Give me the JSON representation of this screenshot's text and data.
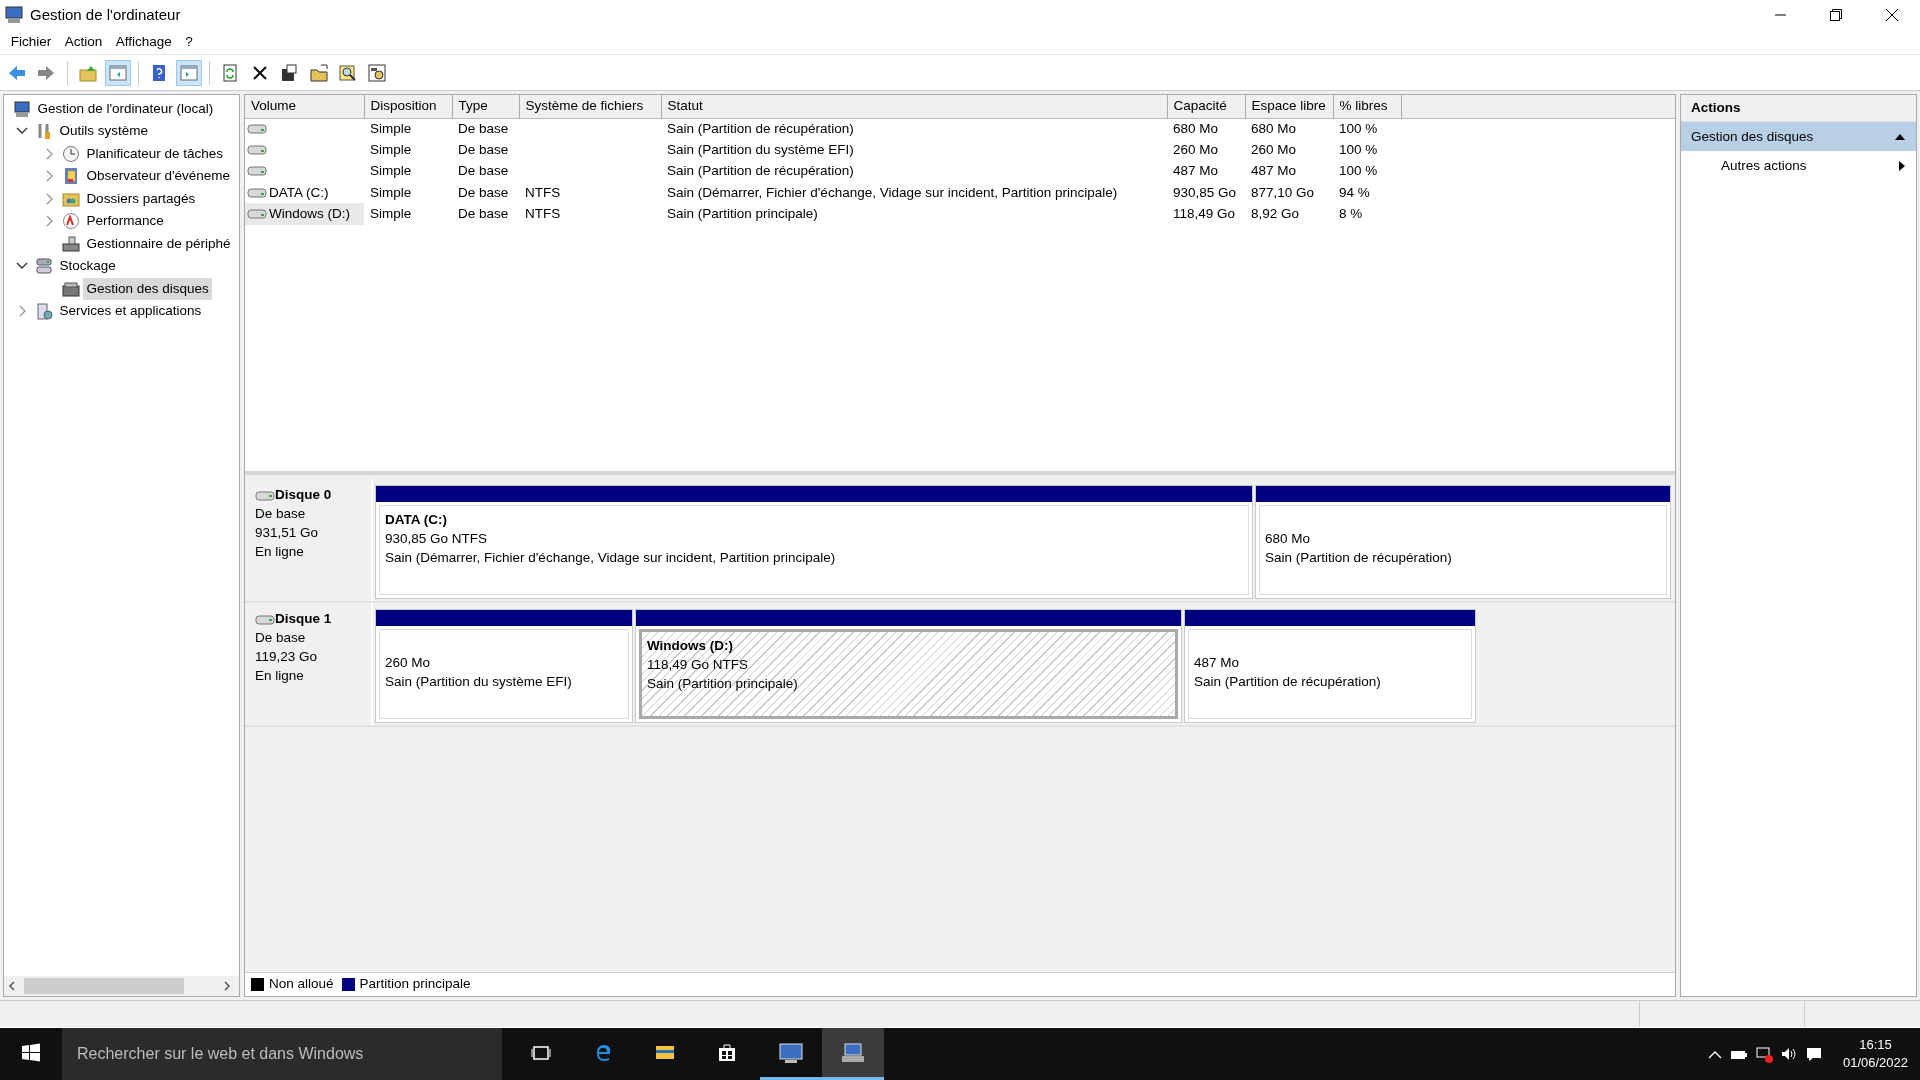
{
  "window": {
    "title": "Gestion de l'ordinateur"
  },
  "menu": [
    "Fichier",
    "Action",
    "Affichage",
    "?"
  ],
  "toolbar": [
    {
      "kind": "back",
      "pressed": false
    },
    {
      "kind": "forward",
      "pressed": false
    },
    {
      "kind": "sep"
    },
    {
      "kind": "up",
      "pressed": false
    },
    {
      "kind": "tree",
      "pressed": true
    },
    {
      "kind": "sep"
    },
    {
      "kind": "help",
      "pressed": false
    },
    {
      "kind": "pane",
      "pressed": true
    },
    {
      "kind": "sep"
    },
    {
      "kind": "refresh",
      "pressed": false
    },
    {
      "kind": "delete",
      "pressed": false
    },
    {
      "kind": "properties",
      "pressed": false
    },
    {
      "kind": "open",
      "pressed": false
    },
    {
      "kind": "find",
      "pressed": false
    },
    {
      "kind": "settings",
      "pressed": false
    }
  ],
  "tree": [
    {
      "label": "Gestion de l'ordinateur (local)",
      "kind": "computer",
      "selected": false,
      "children": [
        {
          "label": "Outils système",
          "kind": "tools",
          "expanded": true,
          "selected": false,
          "children": [
            {
              "label": "Planificateur de tâches",
              "kind": "clock",
              "expanded": false,
              "selected": false
            },
            {
              "label": "Observateur d'événeme",
              "kind": "log",
              "expanded": false,
              "selected": false
            },
            {
              "label": "Dossiers partagés",
              "kind": "folder",
              "expanded": false,
              "selected": false
            },
            {
              "label": "Performance",
              "kind": "perf",
              "expanded": false,
              "selected": false
            },
            {
              "label": "Gestionnaire de périphé",
              "kind": "devices",
              "selected": false
            }
          ]
        },
        {
          "label": "Stockage",
          "kind": "storage",
          "expanded": true,
          "selected": false,
          "children": [
            {
              "label": "Gestion des disques",
              "kind": "disk",
              "selected": true
            }
          ]
        },
        {
          "label": "Services et applications",
          "kind": "services",
          "expanded": false,
          "selected": false
        }
      ]
    }
  ],
  "table": {
    "columns": [
      "Volume",
      "Disposition",
      "Type",
      "Système de fichiers",
      "Statut",
      "Capacité",
      "Espace libre",
      "% libres"
    ],
    "rows": [
      {
        "selected": false,
        "cells": [
          "",
          "Simple",
          "De base",
          "",
          "Sain (Partition de récupération)",
          "680 Mo",
          "680 Mo",
          "100 %"
        ]
      },
      {
        "selected": false,
        "cells": [
          "",
          "Simple",
          "De base",
          "",
          "Sain (Partition du système EFI)",
          "260 Mo",
          "260 Mo",
          "100 %"
        ]
      },
      {
        "selected": false,
        "cells": [
          "",
          "Simple",
          "De base",
          "",
          "Sain (Partition de récupération)",
          "487 Mo",
          "487 Mo",
          "100 %"
        ]
      },
      {
        "selected": false,
        "cells": [
          "DATA (C:)",
          "Simple",
          "De base",
          "NTFS",
          "Sain (Démarrer, Fichier d'échange, Vidage sur incident, Partition principale)",
          "930,85 Go",
          "877,10 Go",
          "94 %"
        ]
      },
      {
        "selected": true,
        "cells": [
          "Windows (D:)",
          "Simple",
          "De base",
          "NTFS",
          "Sain (Partition principale)",
          "118,49 Go",
          "8,92 Go",
          "8 %"
        ]
      }
    ]
  },
  "disks": [
    {
      "name": "Disque 0",
      "type": "De base",
      "size": "931,51 Go",
      "status": "En ligne",
      "partitions": [
        {
          "label": "DATA  (C:)",
          "size": "930,85 Go NTFS",
          "status": "Sain (Démarrer, Fichier d'échange, Vidage sur incident, Partition principale)",
          "selected": false
        },
        {
          "size": "680 Mo",
          "status": "Sain (Partition de récupération)",
          "selected": false
        }
      ]
    },
    {
      "name": "Disque 1",
      "type": "De base",
      "size": "119,23 Go",
      "status": "En ligne",
      "partitions": [
        {
          "size": "260 Mo",
          "status": "Sain (Partition du système EFI)",
          "selected": false
        },
        {
          "label": "Windows  (D:)",
          "size": "118,49 Go NTFS",
          "status": "Sain (Partition principale)",
          "selected": true
        },
        {
          "size": "487 Mo",
          "status": "Sain (Partition de récupération)",
          "selected": false
        }
      ]
    }
  ],
  "legend": [
    {
      "label": "Non alloué",
      "color": "#000000"
    },
    {
      "label": "Partition principale",
      "color": "#000080"
    }
  ],
  "actions": {
    "title": "Actions",
    "sections": [
      {
        "label": "Gestion des disques",
        "expanded": true,
        "items": [
          "Autres actions"
        ]
      }
    ]
  },
  "taskbar": {
    "search": {
      "placeholder": "Rechercher sur le web et dans Windows"
    },
    "apps": [
      {
        "kind": "taskview",
        "running": false,
        "active": false
      },
      {
        "kind": "edge",
        "running": false,
        "active": false
      },
      {
        "kind": "explorer",
        "running": false,
        "active": false
      },
      {
        "kind": "store",
        "running": false,
        "active": false
      },
      {
        "kind": "monitor",
        "running": true,
        "active": false
      },
      {
        "kind": "computer",
        "running": true,
        "active": true
      }
    ],
    "time": "16:15",
    "date": "01/06/2022"
  }
}
